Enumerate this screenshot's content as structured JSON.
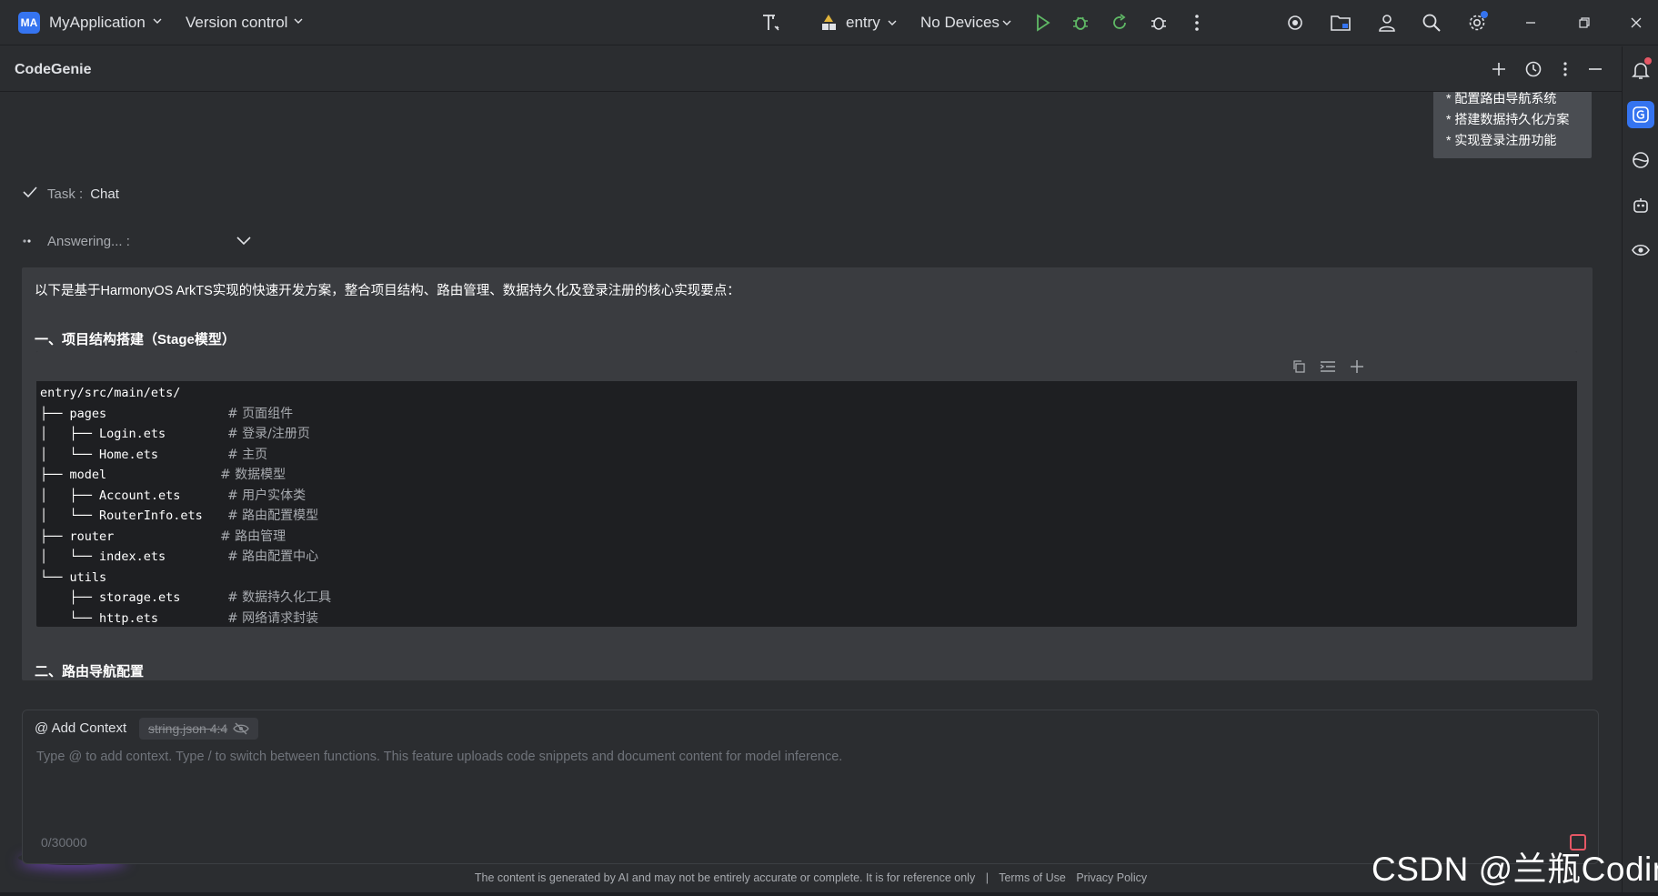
{
  "titlebar": {
    "project_badge": "MA",
    "project_name": "MyApplication",
    "version_control": "Version control",
    "run_config": "entry",
    "device": "No Devices",
    "accent": "#3574f0",
    "run_green": "#5fb865"
  },
  "panel": {
    "title": "CodeGenie"
  },
  "chat": {
    "previous_message_lines": [
      "* 配置路由导航系统",
      "* 搭建数据持久化方案",
      "* 实现登录注册功能"
    ],
    "task_label": "Task :",
    "task_value": "Chat",
    "answering_label": "Answering... :",
    "answer_intro": "以下是基于HarmonyOS ArkTS实现的快速开发方案，整合项目结构、路由管理、数据持久化及登录注册的核心实现要点：",
    "section1_title": "一、项目结构搭建（Stage模型）",
    "section2_title": "二、路由导航配置",
    "code_lines": [
      {
        "code": "entry/src/main/ets/",
        "comment": ""
      },
      {
        "code": "├── pages",
        "comment": "# 页面组件"
      },
      {
        "code": "│   ├── Login.ets",
        "comment": "# 登录/注册页"
      },
      {
        "code": "│   └── Home.ets",
        "comment": "# 主页"
      },
      {
        "code": "├── model",
        "comment": "# 数据模型"
      },
      {
        "code": "│   ├── Account.ets",
        "comment": "# 用户实体类"
      },
      {
        "code": "│   └── RouterInfo.ets",
        "comment": "# 路由配置模型"
      },
      {
        "code": "├── router",
        "comment": "# 路由管理"
      },
      {
        "code": "│   └── index.ets",
        "comment": "# 路由配置中心"
      },
      {
        "code": "└── utils",
        "comment": ""
      },
      {
        "code": "    ├── storage.ets",
        "comment": "# 数据持久化工具"
      },
      {
        "code": "    └── http.ets",
        "comment": "# 网络请求封装"
      }
    ]
  },
  "input": {
    "add_context_label": "@ Add Context",
    "context_chip": "string.json 4:4",
    "placeholder": "Type @ to add context. Type / to switch between functions. This feature uploads code snippets and document content for model inference.",
    "char_count": "0/30000"
  },
  "footer": {
    "disclaimer": "The content is generated by AI and may not be entirely accurate or complete. It is for reference only",
    "separator": "|",
    "terms": "Terms of Use",
    "privacy": "Privacy Policy"
  },
  "watermark": "CSDN @兰瓶Coding"
}
